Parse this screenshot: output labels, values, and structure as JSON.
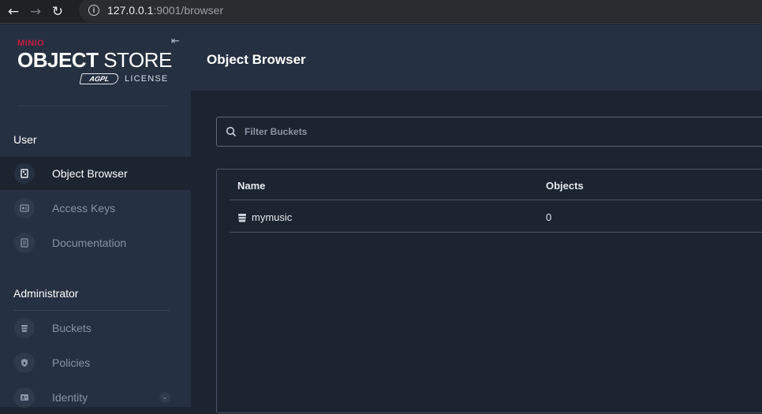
{
  "browser": {
    "url_host": "127.0.0.1",
    "url_rest": ":9001/browser",
    "back_icon": "←",
    "forward_icon": "→",
    "reload_icon": "↻",
    "info_icon": "i"
  },
  "logo": {
    "brand": "MINIO",
    "product_bold": "OBJECT",
    "product_rest": "STORE",
    "license_badge": "AGPL",
    "license_text": "LICENSE"
  },
  "sidebar": {
    "collapse_icon": "⇤",
    "user_section": "User",
    "user_items": [
      {
        "label": "Object Browser",
        "icon": "object-browser-icon"
      },
      {
        "label": "Access Keys",
        "icon": "access-keys-icon"
      },
      {
        "label": "Documentation",
        "icon": "documentation-icon"
      }
    ],
    "admin_section": "Administrator",
    "admin_items": [
      {
        "label": "Buckets",
        "icon": "bucket-icon"
      },
      {
        "label": "Policies",
        "icon": "shield-icon"
      },
      {
        "label": "Identity",
        "icon": "identity-icon"
      }
    ],
    "expand_icon": "⌄"
  },
  "main": {
    "title": "Object Browser",
    "filter_placeholder": "Filter Buckets",
    "table": {
      "headers": [
        "Name",
        "Objects"
      ],
      "rows": [
        {
          "name": "mymusic",
          "objects": "0"
        }
      ]
    }
  },
  "colors": {
    "accent": "#c51c3f",
    "sidebar_bg": "#253041",
    "content_bg": "#1c2430"
  }
}
